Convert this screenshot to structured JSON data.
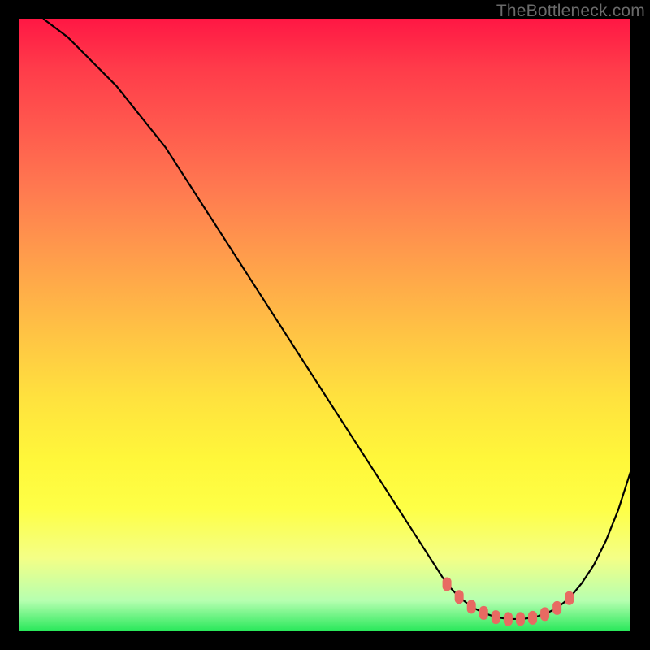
{
  "watermark": "TheBottleneck.com",
  "colors": {
    "frame_border": "#000000",
    "curve_stroke": "#000000",
    "dot_fill": "#e86a62"
  },
  "chart_data": {
    "type": "line",
    "title": "",
    "xlabel": "",
    "ylabel": "",
    "xlim": [
      0,
      100
    ],
    "ylim": [
      0,
      100
    ],
    "grid": false,
    "legend": false,
    "series": [
      {
        "name": "curve",
        "x": [
          4,
          8,
          12,
          16,
          20,
          24,
          28,
          32,
          36,
          40,
          44,
          48,
          52,
          56,
          60,
          64,
          68,
          70,
          72,
          74,
          76,
          78,
          80,
          82,
          84,
          86,
          88,
          90,
          92,
          94,
          96,
          98,
          100
        ],
        "y": [
          100,
          97,
          93,
          89,
          84,
          79,
          72.8,
          66.6,
          60.4,
          54.2,
          48,
          41.8,
          35.6,
          29.4,
          23.2,
          17,
          10.8,
          7.7,
          5.6,
          4,
          3,
          2.3,
          2,
          2,
          2.2,
          2.8,
          3.8,
          5.4,
          7.8,
          10.8,
          14.8,
          19.8,
          26
        ]
      }
    ],
    "markers": {
      "name": "highlighted-points",
      "x": [
        70,
        72,
        74,
        76,
        78,
        80,
        82,
        84,
        86,
        88,
        90
      ],
      "y": [
        7.7,
        5.6,
        4.0,
        3.0,
        2.3,
        2.0,
        2.0,
        2.2,
        2.8,
        3.8,
        5.4
      ],
      "shape": "rounded-rect"
    }
  }
}
